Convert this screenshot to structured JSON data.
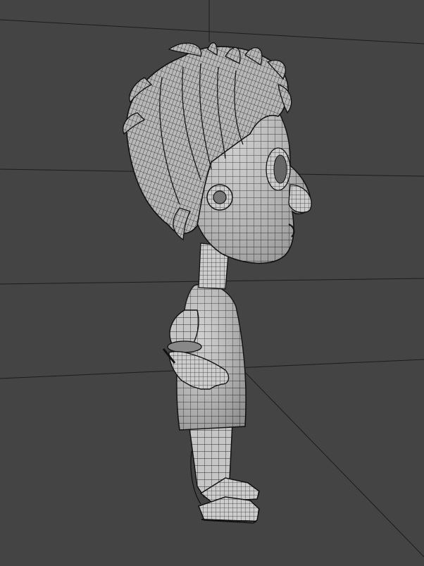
{
  "viewport": {
    "background": "#444444",
    "grid_color": "#1c1c1c"
  },
  "model": {
    "subject": "cartoon-character-wireframe",
    "view": "side-profile",
    "shading": "wireframe-on-shaded",
    "surface_color": "#c9c9c9",
    "wire_color": "#1e1e1e"
  }
}
